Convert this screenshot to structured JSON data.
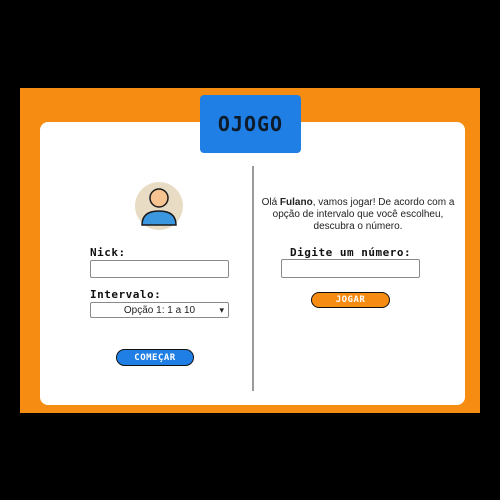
{
  "header": {
    "logo_text": "OJOGO"
  },
  "left": {
    "nick_label": "Nick:",
    "nick_value": "",
    "interval_label": "Intervalo:",
    "interval_selected": "Opção 1: 1 a 10",
    "start_button": "COMEÇAR"
  },
  "right": {
    "greeting_prefix": "Olá ",
    "player_name": "Fulano",
    "greeting_suffix": ", vamos jogar! De acordo com a opção de intervalo que você escolheu, descubra o número.",
    "number_label": "Digite um número:",
    "number_value": "",
    "play_button": "JOGAR"
  },
  "colors": {
    "frame": "#f68c12",
    "logo_bg": "#1f7fe5",
    "start_button": "#1f7fe5",
    "play_button": "#f68c12",
    "avatar_bg": "#e8dcc4",
    "avatar_shirt": "#3a97e0",
    "avatar_skin": "#f6c391"
  },
  "icons": {
    "avatar": "user-avatar-icon",
    "dropdown": "chevron-down-icon"
  }
}
